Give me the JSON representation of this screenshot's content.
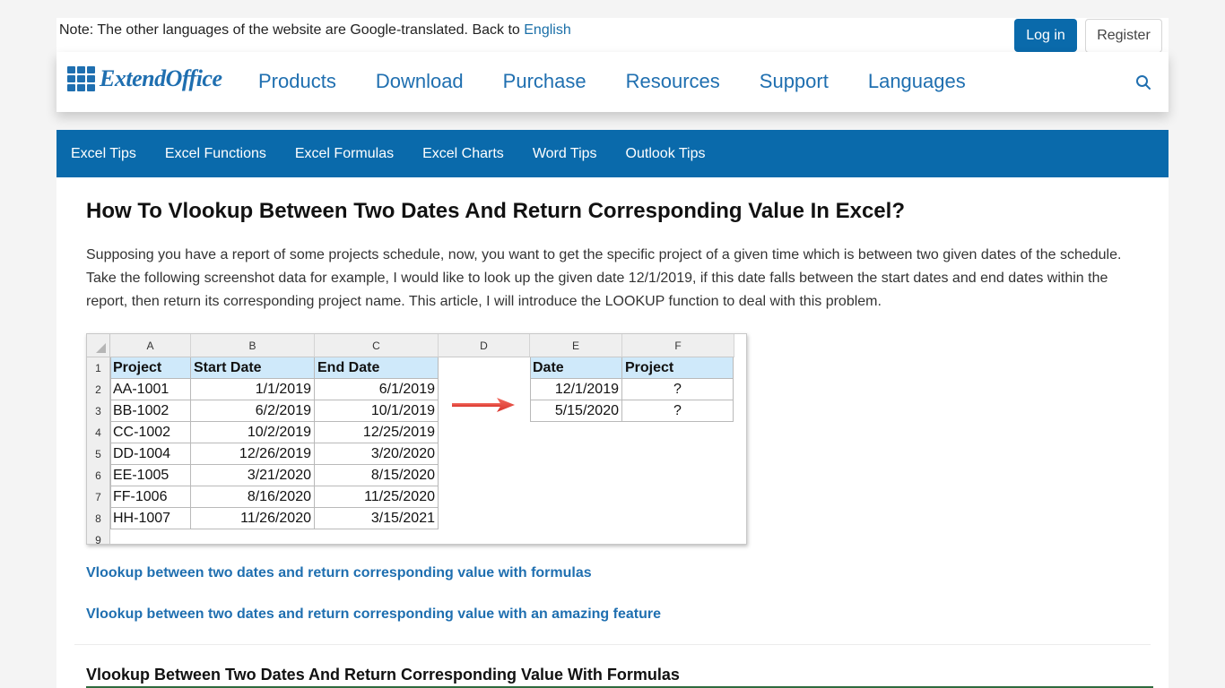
{
  "topbar": {
    "note": "Note: The other languages of the website are Google-translated. Back to ",
    "english_link": "English",
    "login": "Log in",
    "register": "Register"
  },
  "header": {
    "logo_text": "ExtendOffice",
    "nav": [
      "Products",
      "Download",
      "Purchase",
      "Resources",
      "Support",
      "Languages"
    ],
    "search_icon": "search-icon"
  },
  "subnav": [
    "Excel Tips",
    "Excel Functions",
    "Excel Formulas",
    "Excel Charts",
    "Word Tips",
    "Outlook Tips"
  ],
  "article": {
    "title": "How To Vlookup Between Two Dates And Return Corresponding Value In Excel?",
    "intro": "Supposing you have a report of some projects schedule, now, you want to get the specific project of a given time which is between two given dates of the schedule. Take the following screenshot data for example, I would like to look up the given date 12/1/2019, if this date falls between the start dates and end dates within the report, then return its corresponding project name. This article, I will introduce the LOOKUP function to deal with this problem.",
    "links": [
      "Vlookup between two dates and return corresponding value with formulas",
      "Vlookup between two dates and return corresponding value with an amazing feature"
    ],
    "section_heading": "Vlookup Between Two Dates And Return Corresponding Value With Formulas"
  },
  "spreadsheet": {
    "columns": [
      "A",
      "B",
      "C",
      "D",
      "E",
      "F"
    ],
    "row_numbers": [
      "1",
      "2",
      "3",
      "4",
      "5",
      "6",
      "7",
      "8",
      "9"
    ],
    "table1": {
      "headers": [
        "Project",
        "Start Date",
        "End Date"
      ],
      "rows": [
        [
          "AA-1001",
          "1/1/2019",
          "6/1/2019"
        ],
        [
          "BB-1002",
          "6/2/2019",
          "10/1/2019"
        ],
        [
          "CC-1002",
          "10/2/2019",
          "12/25/2019"
        ],
        [
          "DD-1004",
          "12/26/2019",
          "3/20/2020"
        ],
        [
          "EE-1005",
          "3/21/2020",
          "8/15/2020"
        ],
        [
          "FF-1006",
          "8/16/2020",
          "11/25/2020"
        ],
        [
          "HH-1007",
          "11/26/2020",
          "3/15/2021"
        ]
      ]
    },
    "table2": {
      "headers": [
        "Date",
        "Project"
      ],
      "rows": [
        [
          "12/1/2019",
          "?"
        ],
        [
          "5/15/2020",
          "?"
        ]
      ]
    },
    "header_fill": "#cfe9fa",
    "arrow_color": "#e8413a"
  }
}
